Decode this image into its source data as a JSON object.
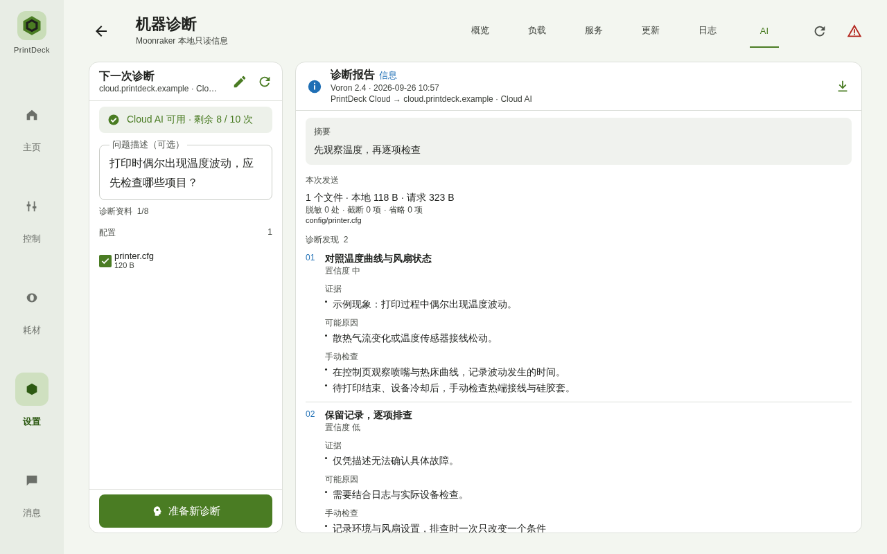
{
  "nav": {
    "brand": "PrintDeck",
    "items": [
      {
        "label": "主页",
        "kind": "home",
        "selected": false
      },
      {
        "label": "控制",
        "kind": "sliders",
        "selected": false
      },
      {
        "label": "耗材",
        "kind": "spool",
        "selected": false
      },
      {
        "label": "设置",
        "kind": "hexagon",
        "selected": true
      },
      {
        "label": "消息",
        "kind": "chat",
        "selected": false
      }
    ]
  },
  "header": {
    "title": "机器诊断",
    "subtitle": "Moonraker 本地只读信息",
    "tabs": [
      {
        "label": "概览",
        "selected": false
      },
      {
        "label": "负载",
        "selected": false
      },
      {
        "label": "服务",
        "selected": false
      },
      {
        "label": "更新",
        "selected": false
      },
      {
        "label": "日志",
        "selected": false
      },
      {
        "label": "AI",
        "selected": true
      }
    ]
  },
  "left": {
    "title": "下一次诊断",
    "subtitle": "cloud.printdeck.example · Clo…",
    "status": "Cloud AI 可用 · 剩余 8 / 10 次",
    "question": {
      "label": "问题描述（可选）",
      "value": "打印时偶尔出现温度波动，应先检查哪些项目？"
    },
    "materials_label": "诊断资料",
    "materials_count": "1/8",
    "groups": [
      {
        "name": "配置",
        "count": "1",
        "files": [
          {
            "name": "printer.cfg",
            "size": "120 B",
            "checked": true
          }
        ]
      }
    ],
    "button": "准备新诊断"
  },
  "report": {
    "title": "诊断报告",
    "badge": "信息",
    "meta": "Voron 2.4 · 2026-09-26 10:57",
    "route": "PrintDeck Cloud → cloud.printdeck.example · Cloud AI",
    "summary": {
      "label": "摘要",
      "text": "先观察温度，再逐项检查"
    },
    "sent": {
      "label": "本次发送",
      "line1": "1 个文件 · 本地 118 B · 请求 323 B",
      "line2": "脱敏 0 处 · 截断 0 项 · 省略 0 项",
      "file": "config/printer.cfg"
    },
    "findings_label": "诊断发现",
    "findings_count": "2",
    "findings": [
      {
        "number": "01",
        "title": "对照温度曲线与风扇状态",
        "confidence": "置信度 中",
        "sections": [
          {
            "label": "证据",
            "items": [
              "示例现象：打印过程中偶尔出现温度波动。"
            ]
          },
          {
            "label": "可能原因",
            "items": [
              "散热气流变化或温度传感器接线松动。"
            ]
          },
          {
            "label": "手动检查",
            "items": [
              "在控制页观察喷嘴与热床曲线，记录波动发生的时间。",
              "待打印结束、设备冷却后，手动检查热端接线与硅胶套。"
            ]
          }
        ]
      },
      {
        "number": "02",
        "title": "保留记录，逐项排查",
        "confidence": "置信度 低",
        "sections": [
          {
            "label": "证据",
            "items": [
              "仅凭描述无法确认具体故障。"
            ]
          },
          {
            "label": "可能原因",
            "items": [
              "需要结合日志与实际设备检查。"
            ]
          },
          {
            "label": "手动检查",
            "items": [
              "记录环境与风扇设置，排查时一次只改变一个条件"
            ]
          }
        ]
      }
    ]
  }
}
